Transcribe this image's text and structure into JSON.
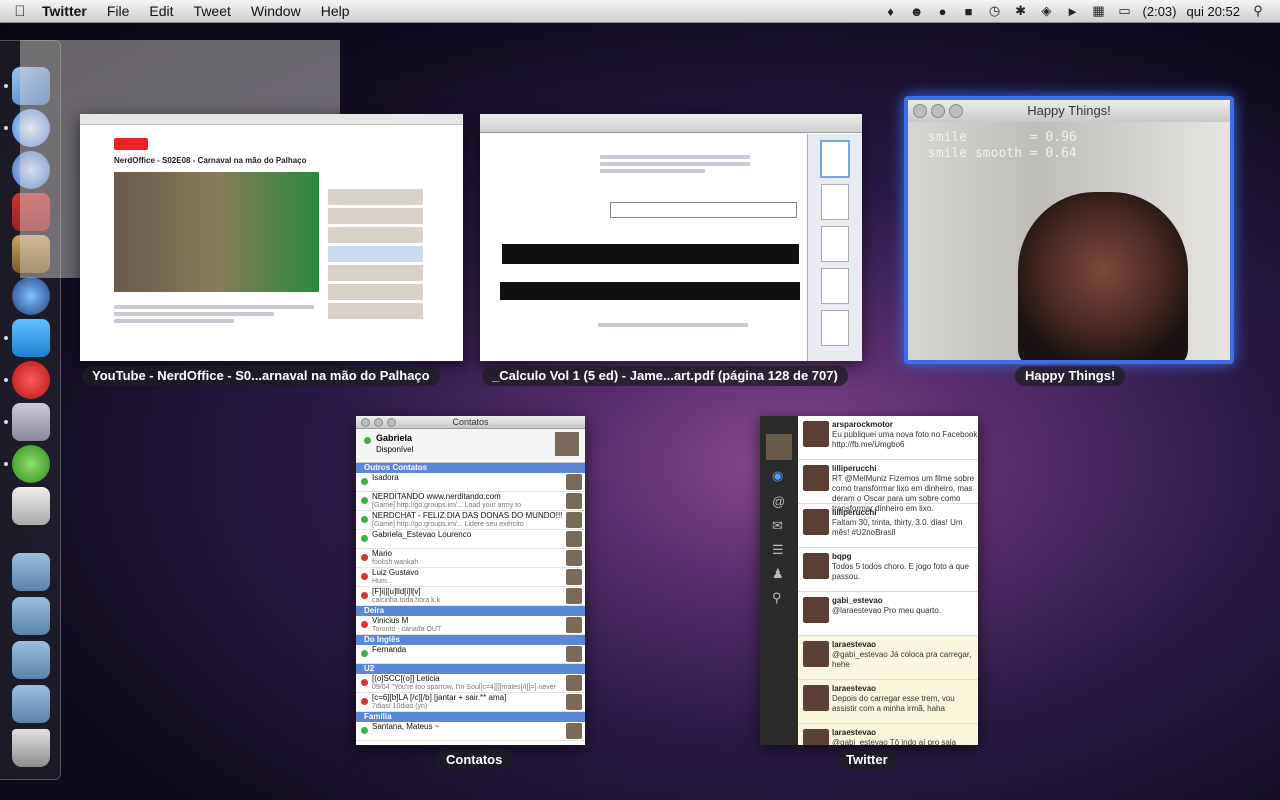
{
  "menubar": {
    "apple": "",
    "app_name": "Twitter",
    "menus": [
      "File",
      "Edit",
      "Tweet",
      "Window",
      "Help"
    ],
    "battery": "(2:03)",
    "clock": "qui 20:52"
  },
  "windows": {
    "youtube": {
      "label": "YouTube - NerdOffice - S0...arnaval na mão do Palhaço",
      "page_title": "NerdOffice - S02E08 - Carnaval na mão do Palhaço"
    },
    "pdf": {
      "label": "_Calculo Vol 1 (5 ed) - Jame...art.pdf (página 128 de 707)"
    },
    "happy": {
      "label": "Happy Things!",
      "title": "Happy Things!",
      "smile_label": "smile",
      "smile_value": "= 0.96",
      "smooth_label": "smile smooth",
      "smooth_value": "= 0.64"
    },
    "contacts": {
      "label": "Contatos",
      "title": "Contatos",
      "user": "Gabriela",
      "status": "Disponível",
      "groups": [
        {
          "name": "Outros Contatos",
          "contacts": [
            {
              "name": "Isadora",
              "status": "",
              "color": "#3cb043"
            },
            {
              "name": "NERDITANDO www.nerditando.com",
              "status": "[Game] http://go.groups.im/... Load your army to",
              "color": "#3cb043"
            },
            {
              "name": "NERDCHAT - FELIZ DIA DAS DONAS DO MUNDO!!!",
              "status": "[Game] http://go.groups.im/... Lidere seu exército",
              "color": "#3cb043"
            },
            {
              "name": "Gabriela_Estevao Lourenco",
              "status": "",
              "color": "#3cb043"
            },
            {
              "name": "Mario",
              "status": "foolish wankah",
              "color": "#d93030"
            },
            {
              "name": "Luiz Gustavo",
              "status": "Hum...",
              "color": "#d93030"
            },
            {
              "name": "[F]i||[u]lld[i]l[v]",
              "status": "calcinha toda hora k.k",
              "color": "#d93030"
            }
          ]
        },
        {
          "name": "Deira",
          "contacts": [
            {
              "name": "Vinicius M",
              "status": "Toronto - canada OUT",
              "color": "#d93030"
            }
          ]
        },
        {
          "name": "Do Inglês",
          "contacts": [
            {
              "name": "Fernanda",
              "status": "",
              "color": "#3cb043"
            }
          ]
        },
        {
          "name": "U2",
          "contacts": [
            {
              "name": "[(o]SCC[(o]] Leticia",
              "status": "09/04 \"You're too sparrow, I'm Soul[c=4]]][mates[/t]]=] never",
              "color": "#d93030"
            },
            {
              "name": "[c=6][b]LA [/c][/b] [jantar + sair.** ama]",
              "status": "7dias/ 10dias (yn)",
              "color": "#d93030"
            }
          ]
        },
        {
          "name": "Familia",
          "contacts": [
            {
              "name": "Santana, Mateus ~",
              "status": "",
              "color": "#3cb043"
            }
          ]
        }
      ]
    },
    "twitter": {
      "label": "Twitter",
      "tweets": [
        {
          "user": "arsparockmotor",
          "text": "Eu publiquei uma nova foto no Facebook http://fb.me/Umgbo6"
        },
        {
          "user": "lilliperucchi",
          "text": "RT @MelMuniz Fizemos um filme sobre como transformar lixo em dinheiro, mas deram o Oscar para um sobre como transformar dinheiro em lixo."
        },
        {
          "user": "lilliperucchi",
          "text": "Faltam 30, trinta, thirty, 3.0. dias! Um mês! #U2noBrasil"
        },
        {
          "user": "bqpg",
          "text": "Todos 5 todos choro. E jogo foto a que passou."
        },
        {
          "user": "gabi_estevao",
          "text": "@laraestevao Pro meu quarto."
        },
        {
          "user": "laraestevao",
          "text": "@gabi_estevao Já coloca pra carregar, hehe"
        },
        {
          "user": "laraestevao",
          "text": "Depois do carregar esse trem, vou assistir com a minha irmã, haha"
        },
        {
          "user": "laraestevao",
          "text": "@gabi_estevao Tô indo aí pro sala então hehe"
        }
      ]
    }
  }
}
